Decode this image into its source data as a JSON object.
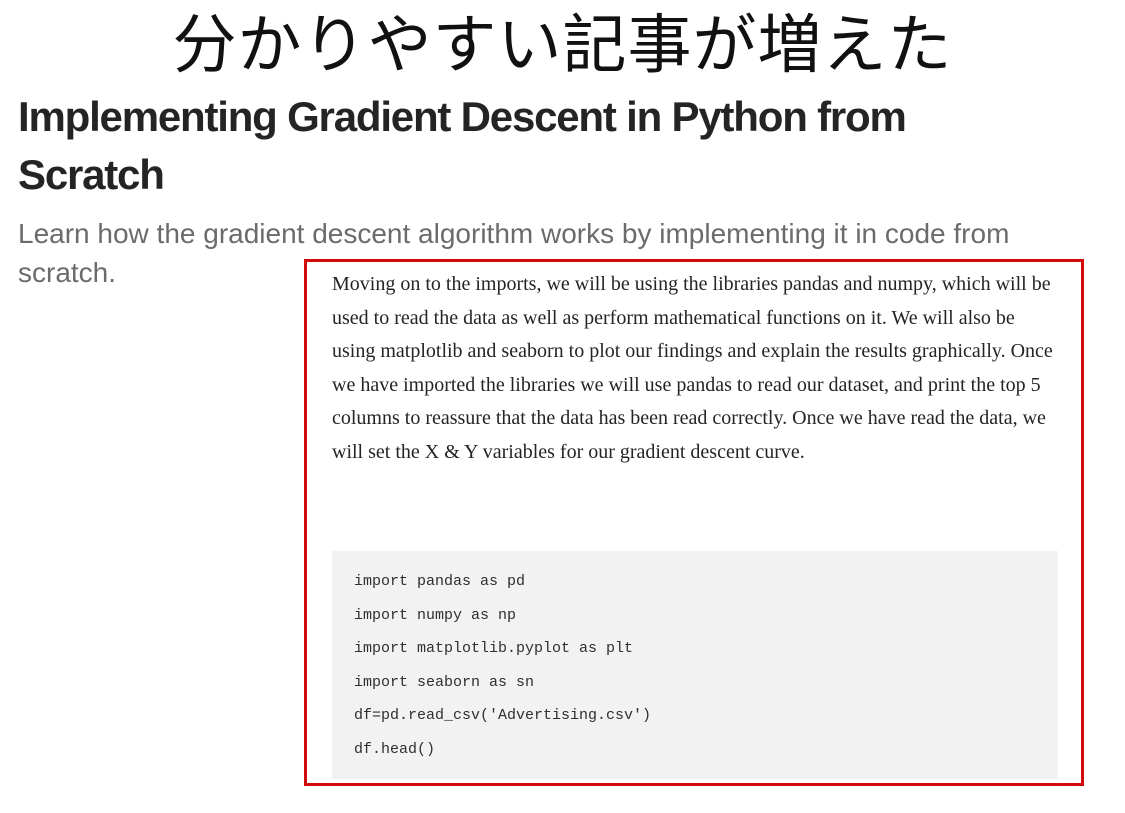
{
  "banner": {
    "text": "分かりやすい記事が増えた"
  },
  "article": {
    "title": "Implementing Gradient Descent in Python from Scratch",
    "subtitle": "Learn how the gradient descent algorithm works by implementing it in code from scratch.",
    "paragraph": "Moving on to the imports, we will be using the libraries pandas and numpy, which will be used to read the data as well as perform mathematical functions on it. We will also be using matplotlib and seaborn to plot our findings and explain the results graphically. Once we have imported the libraries we will use pandas to read our dataset, and print the top 5 columns to reassure that the data has been read correctly. Once we have read the data, we will set the X & Y variables for our gradient descent curve.",
    "code_lines": [
      "import pandas as pd",
      "import numpy as np",
      "import matplotlib.pyplot as plt",
      "import seaborn as sn",
      "df=pd.read_csv('Advertising.csv')",
      "df.head()"
    ]
  },
  "colors": {
    "highlight_border": "#d20a0a",
    "title": "#242424",
    "subtitle": "#6b6b6b",
    "code_background": "#f2f2f2"
  }
}
